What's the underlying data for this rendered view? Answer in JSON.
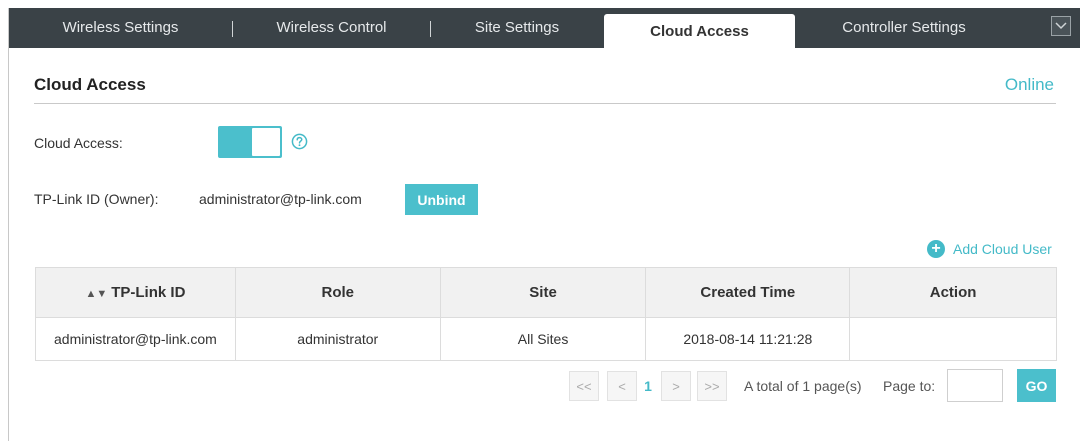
{
  "tabs": [
    {
      "label": "Wireless Settings",
      "active": false
    },
    {
      "label": "Wireless Control",
      "active": false
    },
    {
      "label": "Site Settings",
      "active": false
    },
    {
      "label": "Cloud Access",
      "active": true
    },
    {
      "label": "Controller Settings",
      "active": false
    }
  ],
  "header": {
    "title": "Cloud Access",
    "status": "Online"
  },
  "form": {
    "cloud_access_label": "Cloud Access:",
    "cloud_access_enabled": true,
    "owner_label": "TP-Link ID (Owner):",
    "owner_value": "administrator@tp-link.com",
    "unbind_label": "Unbind"
  },
  "add_cloud_user_label": "Add Cloud User",
  "table": {
    "columns": [
      "TP-Link ID",
      "Role",
      "Site",
      "Created Time",
      "Action"
    ],
    "rows": [
      {
        "tplink_id": "administrator@tp-link.com",
        "role": "administrator",
        "site": "All Sites",
        "created_time": "2018-08-14 11:21:28",
        "action": ""
      }
    ]
  },
  "pagination": {
    "first": "<<",
    "prev": "<",
    "current_page": "1",
    "next": ">",
    "last": ">>",
    "total_text": "A total of 1 page(s)",
    "page_to_label": "Page to:",
    "page_to_value": "",
    "go_label": "GO"
  },
  "colors": {
    "accent": "#4bbfcc",
    "tabbar": "#3a4247"
  }
}
